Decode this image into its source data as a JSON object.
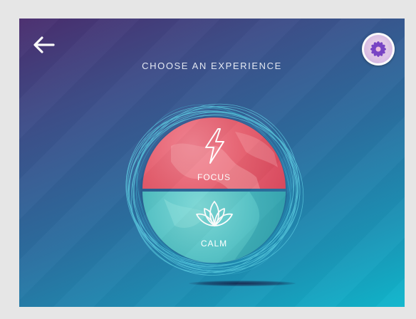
{
  "header": {
    "title": "CHOOSE AN EXPERIENCE"
  },
  "experiences": [
    {
      "label": "FOCUS",
      "icon": "lightning-bolt-icon",
      "color": "#e5606f"
    },
    {
      "label": "CALM",
      "icon": "lotus-icon",
      "color": "#55c1c4"
    }
  ],
  "theme": {
    "gradient_start": "#4a2d6e",
    "gradient_end": "#0fb7cd",
    "avatar_flower": "#7a45c8"
  }
}
